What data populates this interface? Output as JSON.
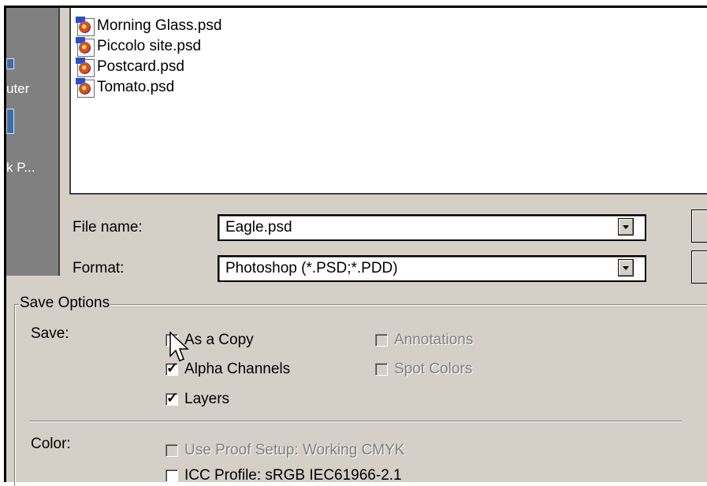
{
  "places_bar": {
    "items": [
      {
        "label": "uter"
      },
      {
        "label": "k P..."
      }
    ]
  },
  "file_list": {
    "files": [
      {
        "name": "Morning Glass.psd"
      },
      {
        "name": "Piccolo site.psd"
      },
      {
        "name": "Postcard.psd"
      },
      {
        "name": "Tomato.psd"
      }
    ]
  },
  "file_name": {
    "label": "File name:",
    "value": "Eagle.psd"
  },
  "format": {
    "label": "Format:",
    "value": "Photoshop (*.PSD;*.PDD)"
  },
  "save_options": {
    "title": "Save Options",
    "save_label": "Save:",
    "checkboxes": [
      {
        "label": "As a Copy",
        "checked": false,
        "enabled": true
      },
      {
        "label": "Alpha Channels",
        "checked": true,
        "enabled": true
      },
      {
        "label": "Layers",
        "checked": true,
        "enabled": true
      },
      {
        "label": "Annotations",
        "checked": false,
        "enabled": false
      },
      {
        "label": "Spot Colors",
        "checked": false,
        "enabled": false
      }
    ],
    "color_label": "Color:",
    "use_proof_setup": {
      "label": "Use Proof Setup:  Working CMYK",
      "checked": false,
      "enabled": false
    },
    "icc_profile": {
      "label": "ICC Profile:  sRGB IEC61966-2.1",
      "checked": false,
      "enabled": true
    }
  }
}
